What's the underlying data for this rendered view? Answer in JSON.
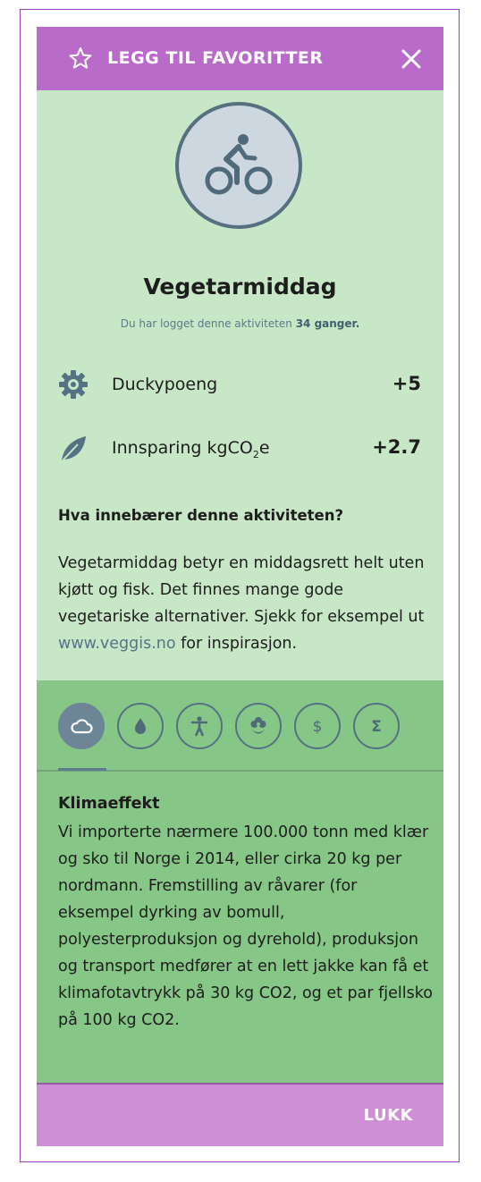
{
  "header": {
    "title": "LEGG TIL FAVORITTER",
    "star_icon": "star-outline-icon",
    "close_icon": "close-icon"
  },
  "activity": {
    "icon": "bicycle-icon",
    "title": "Vegetarmiddag",
    "logged_prefix": "Du har logget denne aktiviteten",
    "logged_count": "34 ganger.",
    "stats": [
      {
        "icon": "gear-icon",
        "label": "Duckypoeng",
        "value": "+5"
      },
      {
        "icon": "leaf-icon",
        "label_prefix": "Innsparing kgCO",
        "label_sub": "2",
        "label_suffix": "e",
        "value": "+2.7"
      }
    ],
    "question": "Hva innebærer denne aktiviteten?",
    "description_text": "Vegetarmiddag betyr en middagsrett helt uten kjøtt og fisk. Det finnes mange gode vegetariske alternativer. Sjekk for eksempel ut ",
    "description_link": "www.veggis.no",
    "description_end": " for inspirasjon."
  },
  "tabs": [
    {
      "icon": "cloud-icon",
      "active": true
    },
    {
      "icon": "water-drop-icon",
      "active": false
    },
    {
      "icon": "person-icon",
      "active": false
    },
    {
      "icon": "flower-icon",
      "active": false
    },
    {
      "icon": "dollar-icon",
      "active": false
    },
    {
      "icon": "sigma-icon",
      "active": false
    }
  ],
  "info": {
    "title": "Klimaeffekt",
    "body": "Vi importerte nærmere 100.000 tonn med klær og sko til Norge i 2014, eller cirka 20 kg per nordmann. Fremstilling av råvarer (for eksempel dyrking av bomull, polyesterproduksjon og dyrehold), produksjon og transport medfører at en lett jakke kan få et klimafotavtrykk på 30 kg CO2, og et par fjellsko på 100 kg CO2."
  },
  "footer": {
    "close_label": "LUKK"
  },
  "colors": {
    "header": "#b96bc9",
    "top_bg": "#c8e7c6",
    "tabs_bg": "#86c686",
    "footer": "#cf8fd6",
    "icon_slate": "#557284",
    "frame": "#9c3eb6"
  }
}
